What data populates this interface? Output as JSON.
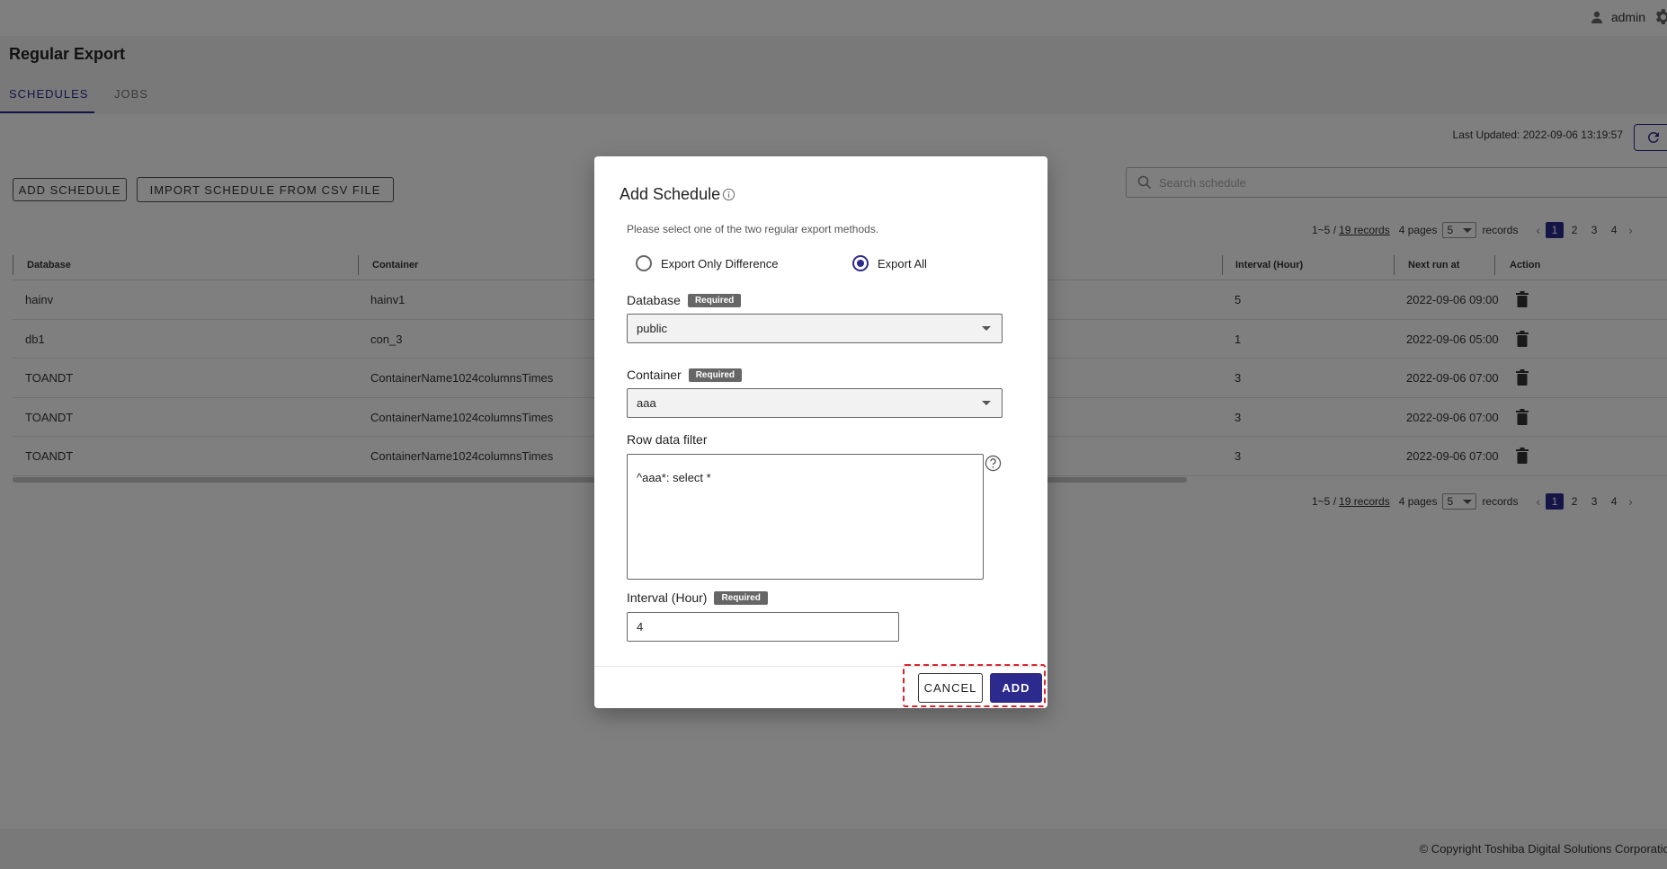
{
  "header": {
    "user_name": "admin",
    "page_title": "Regular Export"
  },
  "tabs": [
    {
      "label": "SCHEDULES"
    },
    {
      "label": "JOBS"
    }
  ],
  "toolbar": {
    "last_updated": "Last Updated: 2022-09-06 13:19:57",
    "add_schedule": "ADD SCHEDULE",
    "import_csv": "IMPORT SCHEDULE FROM CSV FILE",
    "search_placeholder": "Search schedule"
  },
  "pagination": {
    "range": "1~5 /",
    "records_link": "19 records",
    "pages": "4 pages",
    "per_page": "5",
    "records_word": "records",
    "page_numbers": [
      "1",
      "2",
      "3",
      "4"
    ],
    "current_page": "1"
  },
  "table": {
    "columns": {
      "database": "Database",
      "container": "Container",
      "interval": "Interval (Hour)",
      "next_run": "Next run at",
      "action": "Action"
    },
    "rows": [
      {
        "database": "hainv",
        "container": "hainv1",
        "interval": "5",
        "next_run": "2022-09-06 09:00"
      },
      {
        "database": "db1",
        "container": "con_3",
        "interval": "1",
        "next_run": "2022-09-06 05:00"
      },
      {
        "database": "TOANDT",
        "container": "ContainerName1024columnsTimes",
        "interval": "3",
        "next_run": "2022-09-06 07:00"
      },
      {
        "database": "TOANDT",
        "container": "ContainerName1024columnsTimes",
        "interval": "3",
        "next_run": "2022-09-06 07:00"
      },
      {
        "database": "TOANDT",
        "container": "ContainerName1024columnsTimes",
        "interval": "3",
        "next_run": "2022-09-06 07:00"
      }
    ]
  },
  "footer": {
    "copyright": "© Copyright Toshiba Digital Solutions Corporation"
  },
  "dialog": {
    "title": "Add Schedule",
    "description": "Please select one of the two regular export methods.",
    "option_diff": "Export Only Difference",
    "option_all": "Export All",
    "selected_option": "Export All",
    "required_badge": "Required",
    "database_label": "Database",
    "database_value": "public",
    "container_label": "Container",
    "container_value": "aaa",
    "filter_label": "Row data filter",
    "filter_value": "^aaa*: select *",
    "interval_label": "Interval (Hour)",
    "interval_value": "4",
    "cancel": "CANCEL",
    "add": "ADD"
  },
  "colors": {
    "primary": "#2d2a8e",
    "highlight": "#d9232d",
    "overlay": "rgba(0,0,0,0.5)"
  }
}
